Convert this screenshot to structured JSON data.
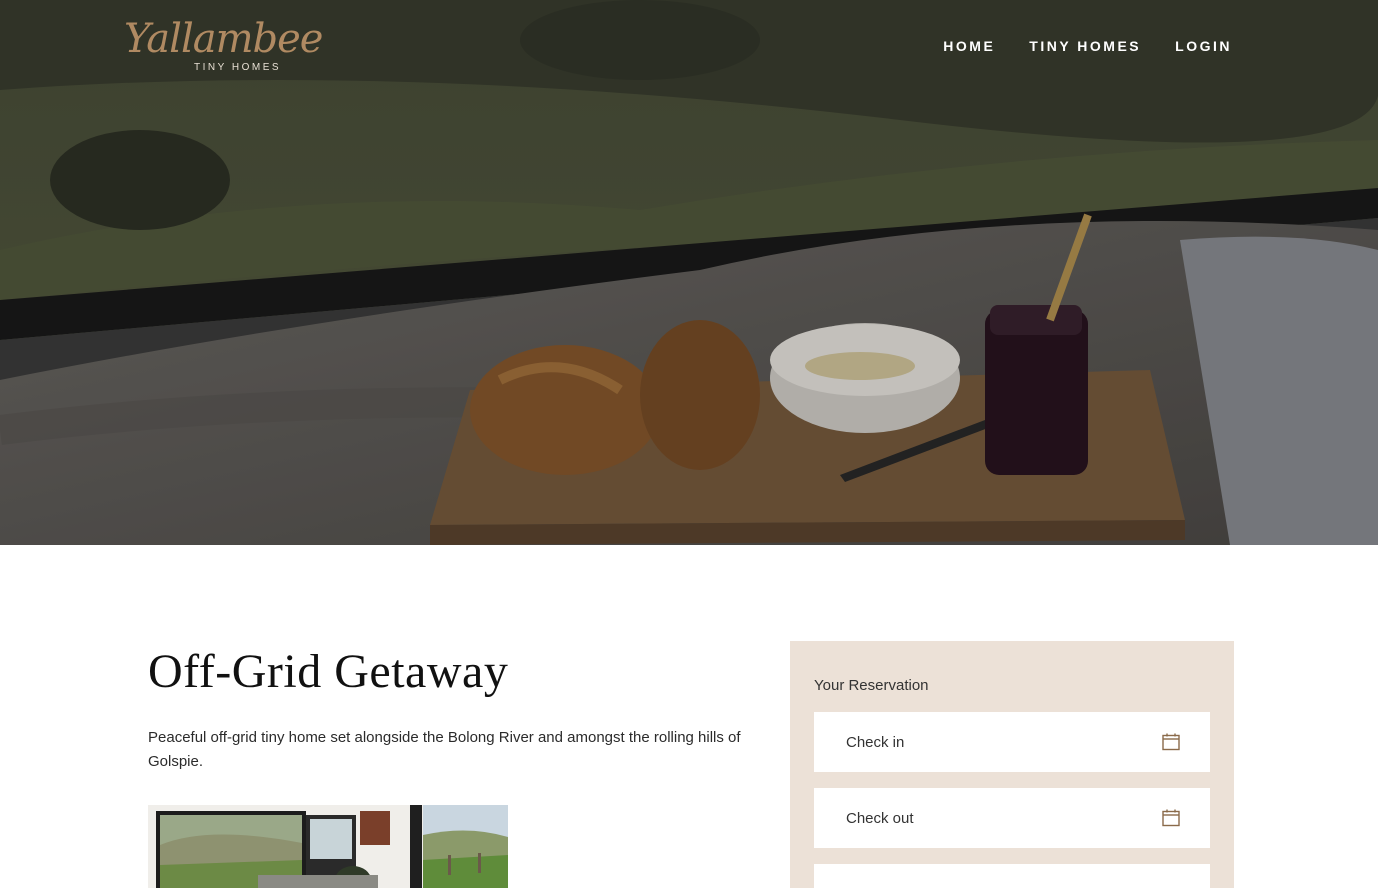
{
  "brand": {
    "script_name": "Yallambee",
    "sub_name": "TINY HOMES"
  },
  "nav": {
    "items": [
      "HOME",
      "TINY HOMES",
      "LOGIN"
    ]
  },
  "listing": {
    "title": "Off-Grid Getaway",
    "description": "Peaceful off-grid tiny home set alongside the Bolong River and amongst the rolling hills of Golspie."
  },
  "reservation": {
    "title": "Your Reservation",
    "check_in_placeholder": "Check in",
    "check_out_placeholder": "Check out"
  },
  "icons": {
    "calendar": "calendar-icon"
  },
  "colors": {
    "brand_gold": "#b08a62",
    "reservation_bg": "#ece1d7"
  }
}
